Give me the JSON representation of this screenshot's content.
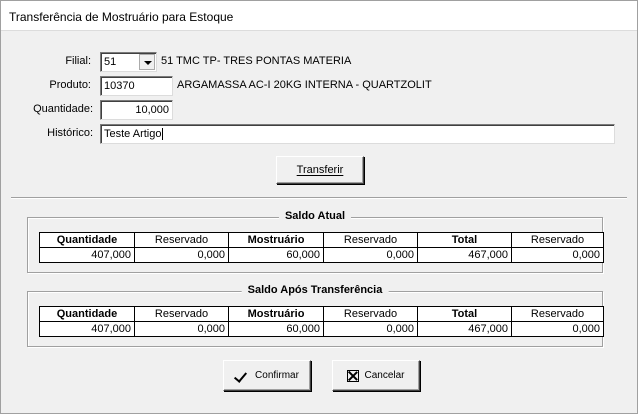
{
  "window": {
    "title": "Transferência de Mostruário para Estoque"
  },
  "form": {
    "filial": {
      "label": "Filial:",
      "value": "51",
      "description": "51 TMC TP- TRES PONTAS MATERIA"
    },
    "produto": {
      "label": "Produto:",
      "value": "10370",
      "description": "ARGAMASSA AC-I 20KG INTERNA - QUARTZOLIT"
    },
    "quantidade": {
      "label": "Quantidade:",
      "value": "10,000"
    },
    "historico": {
      "label": "Histórico:",
      "value": "Teste Artigo"
    }
  },
  "buttons": {
    "transferir": "Transferir",
    "confirmar": "Confirmar",
    "cancelar": "Cancelar"
  },
  "saldo_atual": {
    "title": "Saldo Atual",
    "headers": [
      "Quantidade",
      "Reservado",
      "Mostruário",
      "Reservado",
      "Total",
      "Reservado"
    ],
    "values": [
      "407,000",
      "0,000",
      "60,000",
      "0,000",
      "467,000",
      "0,000"
    ]
  },
  "saldo_apos": {
    "title": "Saldo Após Transferência",
    "headers": [
      "Quantidade",
      "Reservado",
      "Mostruário",
      "Reservado",
      "Total",
      "Reservado"
    ],
    "values": [
      "407,000",
      "0,000",
      "60,000",
      "0,000",
      "467,000",
      "0,000"
    ]
  }
}
